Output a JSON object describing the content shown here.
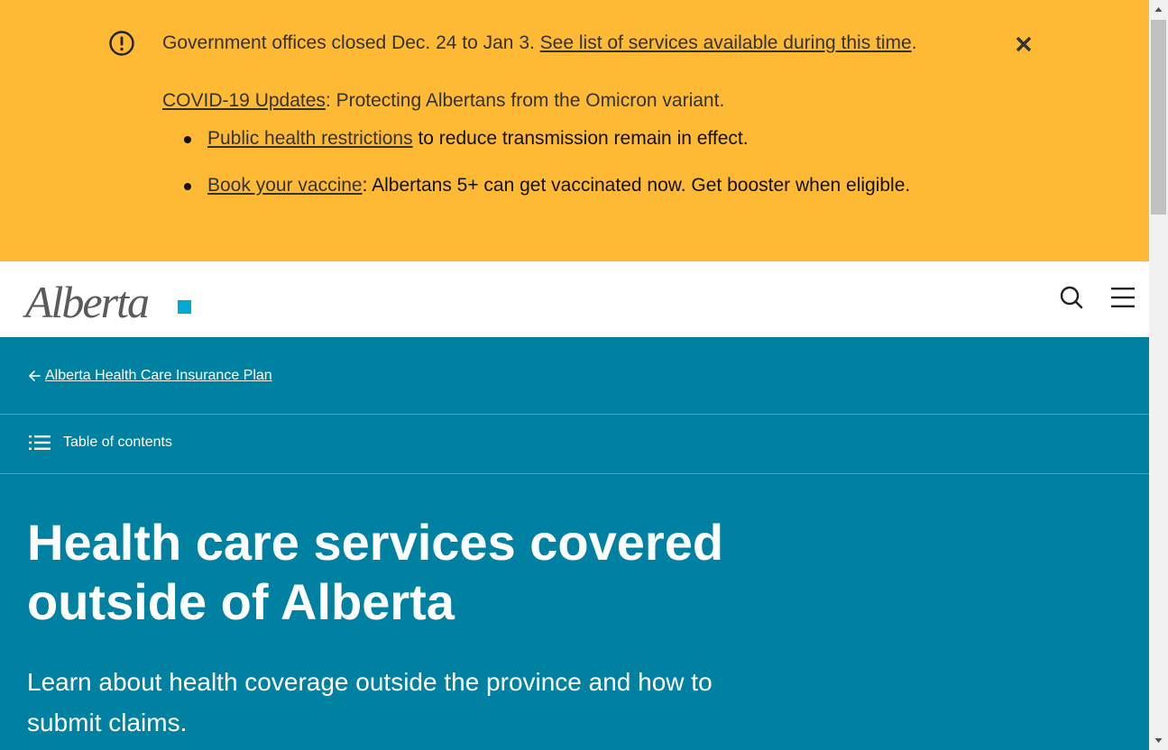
{
  "alert": {
    "closure_text": "Government offices closed Dec. 24 to Jan 3. ",
    "closure_link": "See list of services available during this time",
    "closure_end": ".",
    "covid_link": "COVID-19 Updates",
    "covid_text": ": Protecting Albertans from the Omicron variant.",
    "bullets": [
      {
        "link": "Public health restrictions",
        "text": " to reduce transmission remain in effect."
      },
      {
        "link": "Book your vaccine",
        "text": ": Albertans 5+ can get vaccinated now. Get booster when eligible."
      }
    ],
    "icons": {
      "warning": "exclamation-circle-icon",
      "close": "close-x-icon"
    },
    "background_color": "#feba35"
  },
  "header": {
    "logo_text": "Alberta",
    "logo_accent_color": "#00aad2",
    "icons": {
      "search": "search-icon",
      "menu": "hamburger-menu-icon"
    }
  },
  "hero": {
    "breadcrumb": "Alberta Health Care Insurance Plan",
    "toc_label": "Table of contents",
    "title": "Health care services covered outside of Alberta",
    "lead": "Learn about health coverage outside the province and how to submit claims.",
    "background_color": "#0081a2"
  }
}
